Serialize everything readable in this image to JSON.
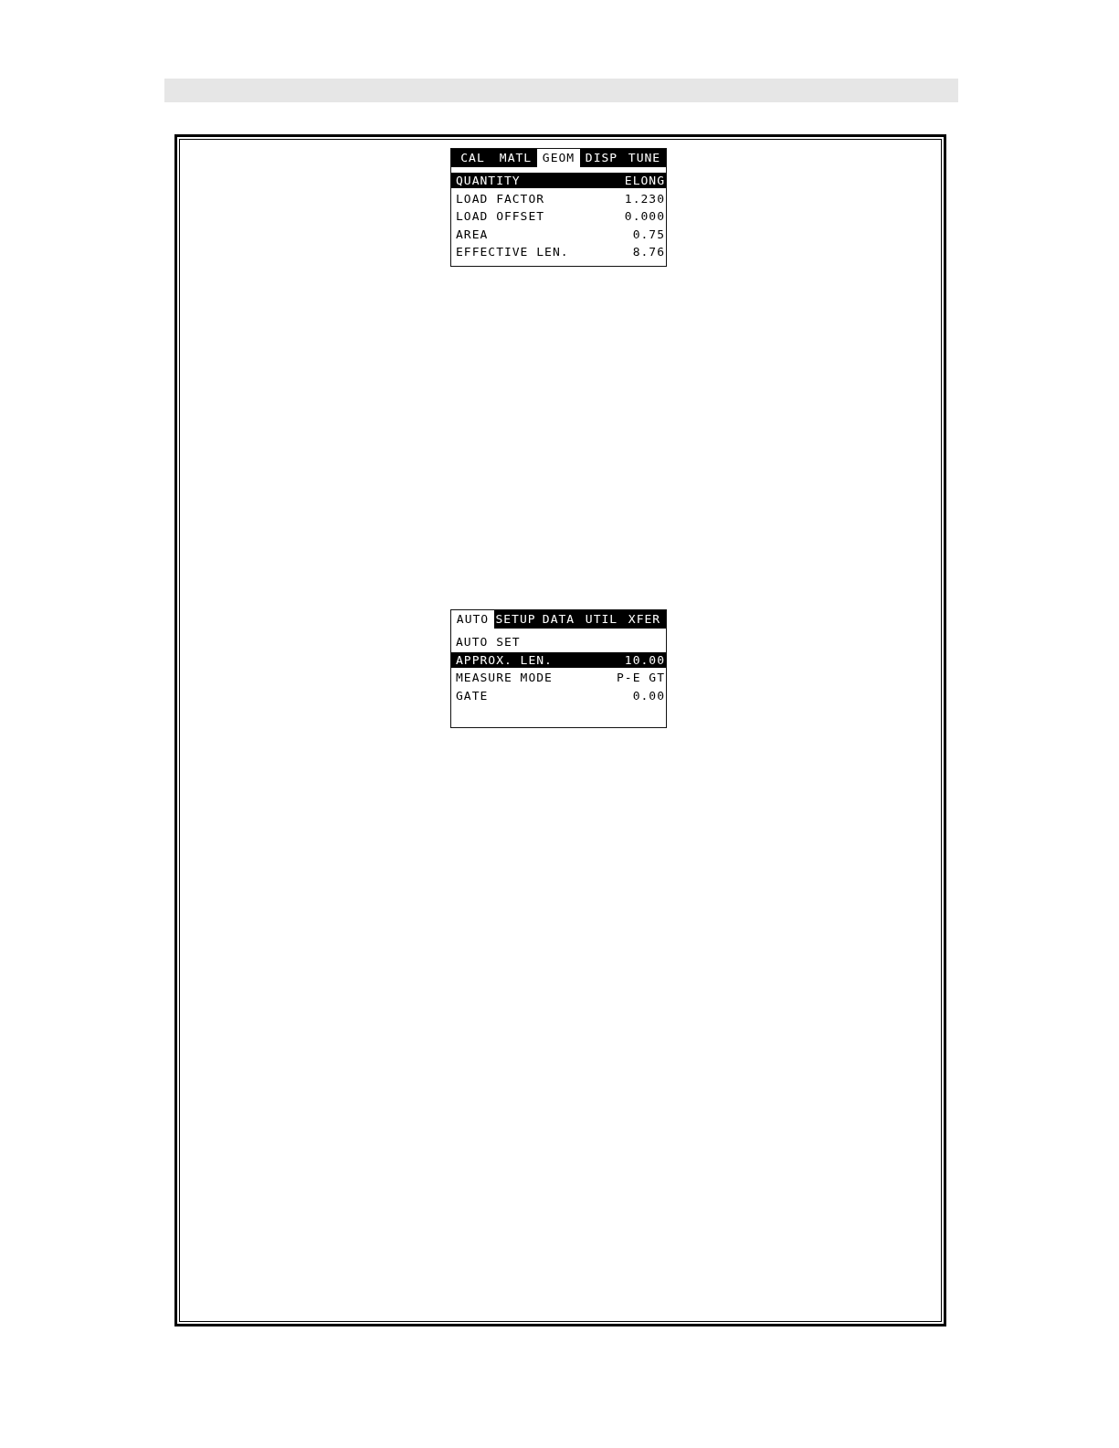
{
  "screens": [
    {
      "tabs": [
        {
          "label": "CAL",
          "selected": false
        },
        {
          "label": "MATL",
          "selected": false
        },
        {
          "label": "GEOM",
          "selected": true
        },
        {
          "label": "DISP",
          "selected": false
        },
        {
          "label": "TUNE",
          "selected": false
        }
      ],
      "rows": [
        {
          "label": "QUANTITY",
          "value": "ELONG",
          "selected": true
        },
        {
          "label": "LOAD FACTOR",
          "value": "1.230",
          "selected": false
        },
        {
          "label": "LOAD OFFSET",
          "value": "0.000",
          "selected": false
        },
        {
          "label": "AREA",
          "value": "0.75",
          "selected": false
        },
        {
          "label": "EFFECTIVE LEN.",
          "value": "8.76",
          "selected": false
        }
      ]
    },
    {
      "tabs": [
        {
          "label": "AUTO",
          "selected": true
        },
        {
          "label": "SETUP",
          "selected": false
        },
        {
          "label": "DATA",
          "selected": false
        },
        {
          "label": "UTIL",
          "selected": false
        },
        {
          "label": "XFER",
          "selected": false
        }
      ],
      "rows": [
        {
          "label": "AUTO SET",
          "selected": false
        },
        {
          "label": "APPROX. LEN.",
          "value": "10.00",
          "selected": true
        },
        {
          "label": "MEASURE MODE",
          "value": "P-E GT",
          "selected": false
        },
        {
          "label": "GATE",
          "value": "0.00",
          "selected": false
        }
      ]
    }
  ]
}
